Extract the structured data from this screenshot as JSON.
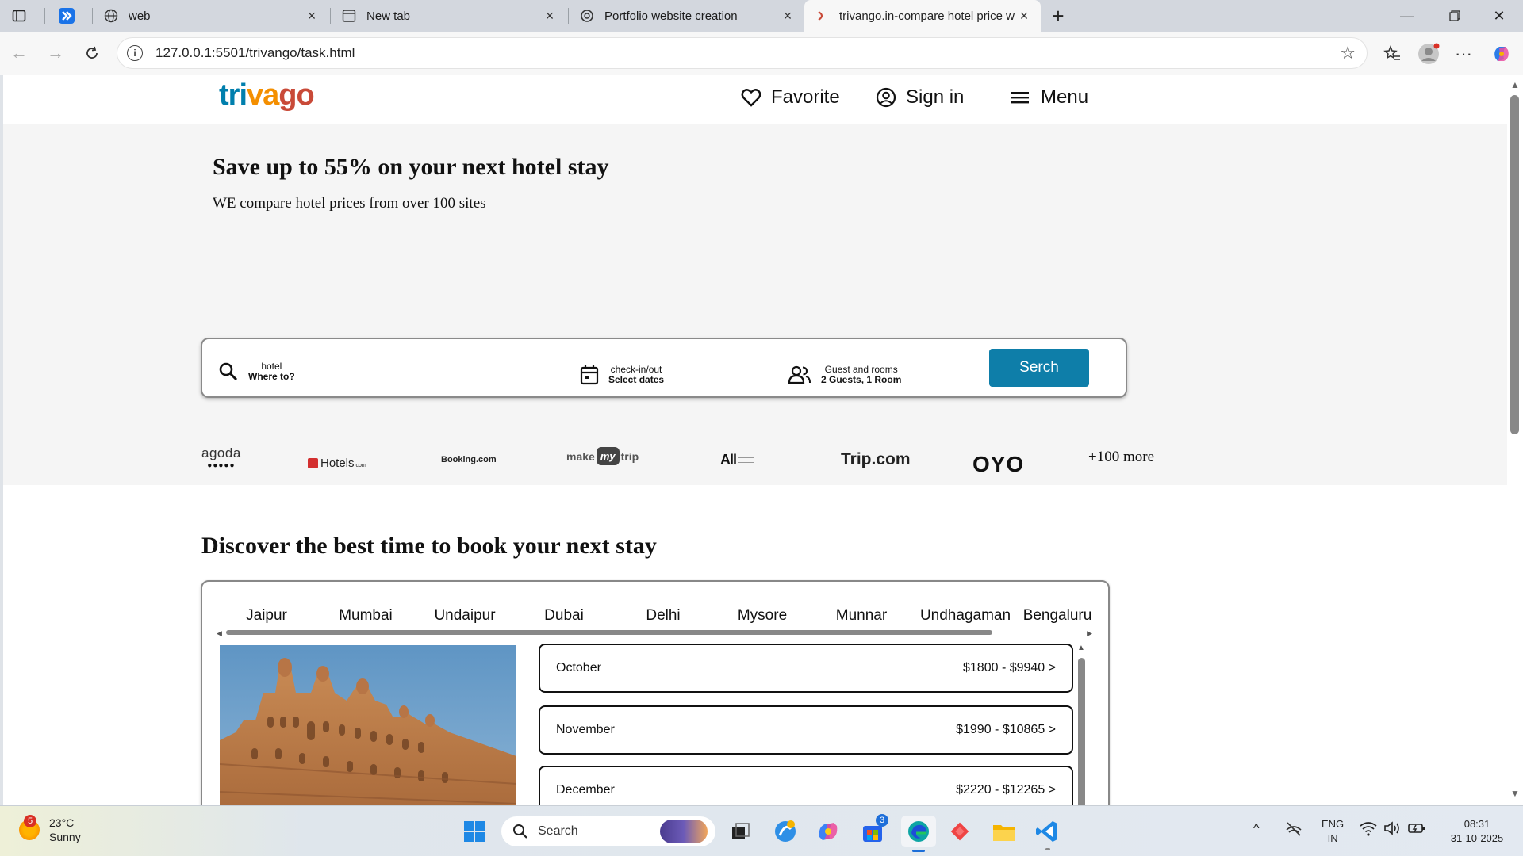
{
  "browser": {
    "tabs": [
      {
        "title": "web",
        "active": false
      },
      {
        "title": "New tab",
        "active": false
      },
      {
        "title": "Portfolio website creation",
        "active": false
      },
      {
        "title": "trivango.in-compare hotel price w",
        "active": true
      }
    ],
    "url": "127.0.0.1:5501/trivango/task.html"
  },
  "site": {
    "logo": {
      "part1": "tri",
      "part2": "va",
      "part3": "go"
    },
    "nav": {
      "favorite": "Favorite",
      "signin": "Sign in",
      "menu": "Menu"
    },
    "hero": {
      "title": "Save up to 55% on your next hotel stay",
      "subtitle": "WE compare hotel prices from over 100 sites"
    },
    "search": {
      "where_label": "hotel",
      "where_value": "Where to?",
      "dates_label": "check-in/out",
      "dates_value": "Select dates",
      "guests_label": "Guest and rooms",
      "guests_value": "2 Guests, 1 Room",
      "button": "Serch"
    },
    "partners": {
      "agoda": "agoda",
      "hotels": "Hotels",
      "hotels_suffix": ".com",
      "booking": "Booking.com",
      "mmt_make": "make",
      "mmt_my": "my",
      "mmt_trip": "trip",
      "all": "All",
      "trip": "Trip.com",
      "oyo": "OYO",
      "more": "+100 more"
    },
    "discover": {
      "title": "Discover the best time to book your next stay",
      "cities": [
        "Jaipur",
        "Mumbai",
        "Undaipur",
        "Dubai",
        "Delhi",
        "Mysore",
        "Munnar",
        "Undhagaman",
        "Bengaluru"
      ],
      "months": [
        {
          "month": "October",
          "price": "$1800 - $9940 >"
        },
        {
          "month": "November",
          "price": "$1990 - $10865 >"
        },
        {
          "month": "December",
          "price": "$2220 - $12265 >"
        }
      ]
    }
  },
  "taskbar": {
    "weather_temp": "23°C",
    "weather_desc": "Sunny",
    "weather_badge": "5",
    "search_placeholder": "Search",
    "store_badge": "3",
    "lang_top": "ENG",
    "lang_bottom": "IN",
    "time": "08:31",
    "date": "31-10-2025"
  },
  "colors": {
    "brand_blue": "#007fad",
    "brand_orange": "#f48f00",
    "brand_red": "#c94a38",
    "search_button": "#0e7ea9"
  }
}
